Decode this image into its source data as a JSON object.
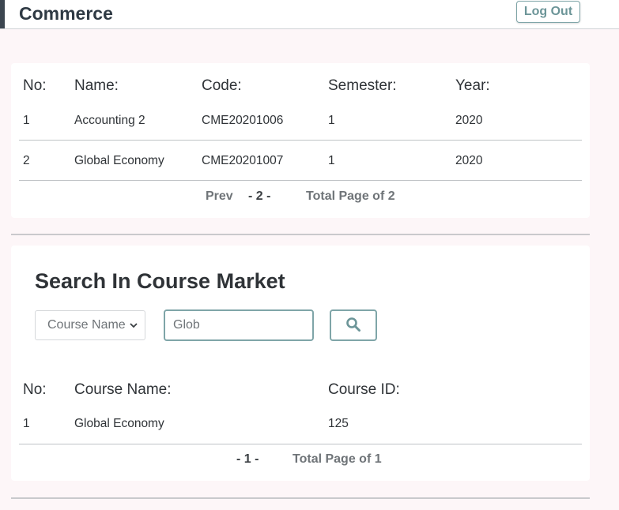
{
  "header": {
    "brand": "Commerce",
    "logout_label": "Log Out"
  },
  "courses_table": {
    "headers": [
      "No:",
      "Name:",
      "Code:",
      "Semester:",
      "Year:"
    ],
    "rows": [
      [
        "1",
        "Accounting 2",
        "CME20201006",
        "1",
        "2020"
      ],
      [
        "2",
        "Global Economy",
        "CME20201007",
        "1",
        "2020"
      ]
    ],
    "pager": {
      "prev_label": "Prev",
      "current": "- 2 -",
      "total": "Total Page of 2"
    }
  },
  "market_search": {
    "title": "Search In Course Market",
    "select_value": "Course Name",
    "search_value": "Glob",
    "headers": [
      "No:",
      "Course Name:",
      "Course ID:"
    ],
    "rows": [
      [
        "1",
        "Global Economy",
        "125"
      ]
    ],
    "pager": {
      "current": "- 1 -",
      "total": "Total Page of 1"
    }
  },
  "colors": {
    "accent": "#7fa5a8",
    "page_bg": "#fdf6f8"
  },
  "icons": {
    "search_button": "search-icon",
    "select_arrow": "chevron-down-icon"
  }
}
